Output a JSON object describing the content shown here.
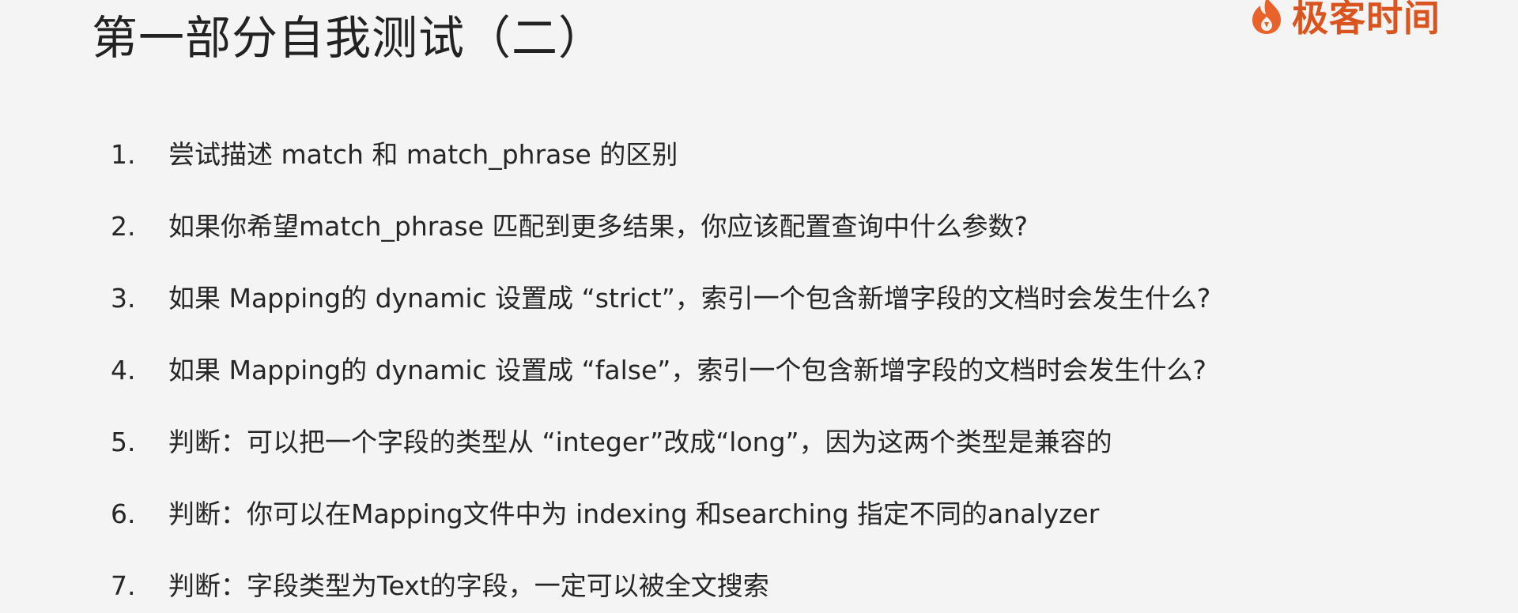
{
  "slide": {
    "title": "第一部分自我测试（二）",
    "logo": {
      "text": "极客时间",
      "icon": "geektime-flame-icon",
      "color": "#d9541e"
    },
    "questions": [
      {
        "num": "1.",
        "text": "尝试描述 match 和 match_phrase 的区别"
      },
      {
        "num": "2.",
        "text": "如果你希望match_phrase 匹配到更多结果，你应该配置查询中什么参数?"
      },
      {
        "num": "3.",
        "text": "如果 Mapping的 dynamic 设置成 “strict”，索引一个包含新增字段的文档时会发生什么?"
      },
      {
        "num": "4.",
        "text": "如果 Mapping的 dynamic 设置成 “false”，索引一个包含新增字段的文档时会发生什么?"
      },
      {
        "num": "5.",
        "text": "判断：可以把一个字段的类型从 “integer”改成“long”，因为这两个类型是兼容的"
      },
      {
        "num": "6.",
        "text": "判断：你可以在Mapping文件中为 indexing 和searching 指定不同的analyzer"
      },
      {
        "num": "7.",
        "text": "判断：字段类型为Text的字段，一定可以被全文搜索"
      }
    ]
  }
}
